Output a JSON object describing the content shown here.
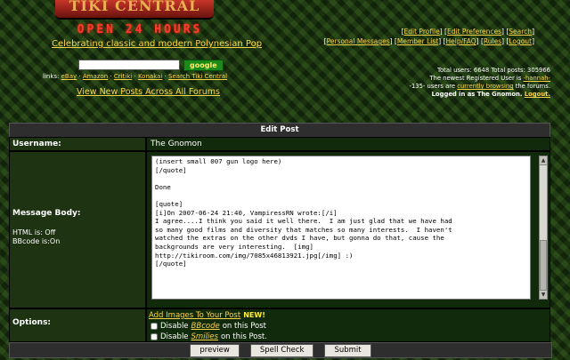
{
  "header": {
    "logo_text": "TIKI CENTRAL",
    "sign_text": "OPEN 24 HOURS",
    "tagline": "Celebrating classic and modern Polynesian Pop",
    "search_button": "google",
    "links_prefix": "links:",
    "links": [
      "eBay",
      "Amazon",
      "Critiki",
      "Konakai",
      "Search Tiki Central"
    ],
    "new_posts": "View New Posts Across All Forums"
  },
  "topnav": {
    "row1": [
      "Edit Profile",
      "Edit Preferences",
      "Search"
    ],
    "row2": [
      "Personal Messages",
      "Member List",
      "Help/FAQ",
      "Rules",
      "Logout"
    ]
  },
  "stats": {
    "line1": "Total users: 6648  Total posts: 305966",
    "line2_prefix": "The newest Registered User is ",
    "newest_user": "-hannah-",
    "line3_prefix": "-135- users are ",
    "browsing_link": "currently browsing",
    "line3_suffix": " the forums.",
    "line4_prefix": "Logged in as The Gnomon. ",
    "logout_link": "Logout."
  },
  "form": {
    "title": "Edit Post",
    "username_label": "Username:",
    "username_value": "The Gnomon",
    "message_label": "Message Body:",
    "html_status": "HTML is: Off",
    "bbcode_status": "BBcode is:On",
    "message_text": "(insert small 007 gun logo here)\n[/quote]\n\nDone\n\n[quote]\n[i]On 2007-06-24 21:40, VampiressRN wrote:[/i]\nI agree....I think you said it well there.  I am just glad that we have had\nso many good films and diversity that matches so many interests.  I haven't\nwatched the extras on the other dvds I have, but gonna do that, cause the\nbackgrounds are very interesting.  [img]\nhttp://tikiroom.com/img/7085x46813921.jpg[/img] :)\n[/quote]",
    "options_label": "Options:",
    "add_images": "Add Images To Your Post",
    "new_badge": "NEW!",
    "disable_bbcode_pre": "Disable",
    "disable_bbcode_link": "BBcode",
    "disable_bbcode_post": "on this Post",
    "disable_smilies_pre": "Disable",
    "disable_smilies_link": "Smilies",
    "disable_smilies_post": "on this Post.",
    "btn_preview": "preview",
    "btn_spell": "Spell Check",
    "btn_submit": "Submit"
  }
}
